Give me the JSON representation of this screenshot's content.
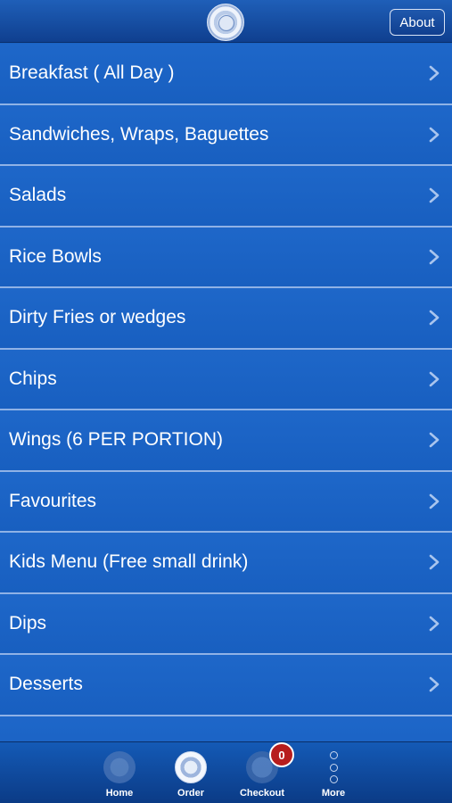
{
  "header": {
    "about_label": "About"
  },
  "menu": {
    "items": [
      {
        "label": "Breakfast ( All Day )"
      },
      {
        "label": "Sandwiches, Wraps, Baguettes"
      },
      {
        "label": "Salads"
      },
      {
        "label": "Rice Bowls"
      },
      {
        "label": "Dirty Fries or wedges"
      },
      {
        "label": "Chips"
      },
      {
        "label": "Wings (6 PER PORTION)"
      },
      {
        "label": "Favourites"
      },
      {
        "label": "Kids Menu (Free small drink)"
      },
      {
        "label": "Dips"
      },
      {
        "label": "Desserts"
      }
    ]
  },
  "tabbar": {
    "home": "Home",
    "order": "Order",
    "checkout": "Checkout",
    "more": "More",
    "cart_count": "0"
  }
}
